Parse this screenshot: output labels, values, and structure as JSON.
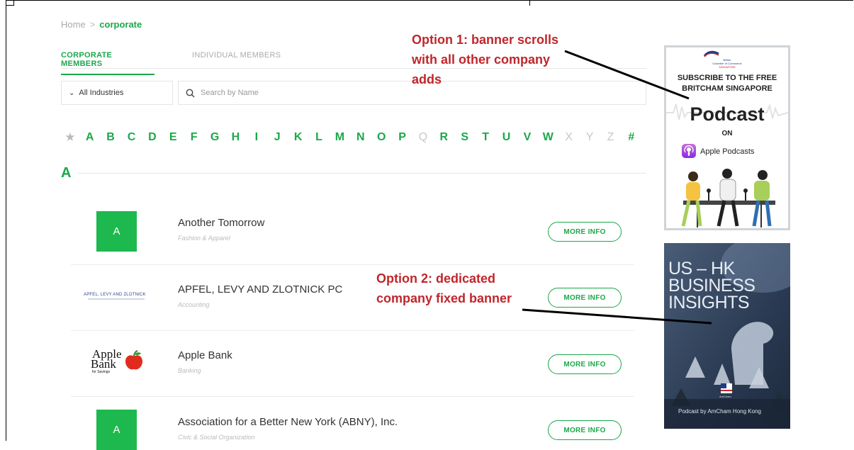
{
  "breadcrumb": {
    "home": "Home",
    "separator": ">",
    "current": "corporate"
  },
  "tabs": {
    "corporate": "CORPORATE MEMBERS",
    "individual": "INDIVIDUAL MEMBERS"
  },
  "filter": {
    "industries": "All Industries",
    "search_placeholder": "Search by Name"
  },
  "alphabet": {
    "enabled": [
      "A",
      "B",
      "C",
      "D",
      "E",
      "F",
      "G",
      "H",
      "I",
      "J",
      "K",
      "L",
      "M",
      "N",
      "O",
      "P",
      "R",
      "S",
      "T",
      "U",
      "V",
      "W",
      "#"
    ],
    "letters": [
      "A",
      "B",
      "C",
      "D",
      "E",
      "F",
      "G",
      "H",
      "I",
      "J",
      "K",
      "L",
      "M",
      "N",
      "O",
      "P",
      "Q",
      "R",
      "S",
      "T",
      "U",
      "V",
      "W",
      "X",
      "Y",
      "Z",
      "#"
    ]
  },
  "section_letter": "A",
  "companies": [
    {
      "name": "Another Tomorrow",
      "category": "Fashion & Apparel",
      "logo_letter": "A"
    },
    {
      "name": "APFEL, LEVY AND ZLOTNICK PC",
      "category": "Accounting",
      "logo_text": "APFEL, LEVY AND ZLOTNICK"
    },
    {
      "name": "Apple Bank",
      "category": "Banking",
      "logo_text_1": "Apple",
      "logo_text_2": "Bank",
      "logo_text_3": "for Savings"
    },
    {
      "name": "Association for a Better New York (ABNY), Inc.",
      "category": "Civic & Social Organization",
      "logo_letter": "A"
    }
  ],
  "more_info_label": "MORE INFO",
  "annotations": {
    "option1_line1": "Option 1: banner scrolls",
    "option1_line2": "with all other company",
    "option1_line3": "adds",
    "option2_line1": "Option 2: dedicated",
    "option2_line2": "company fixed banner"
  },
  "banner1": {
    "org_line1": "British",
    "org_line2": "Chamber of Commerce",
    "org_line3": "SINGAPORE",
    "headline1": "SUBSCRIBE TO THE FREE",
    "headline2": "BRITCHAM SINGAPORE",
    "podcast": "Podcast",
    "on": "ON",
    "platform": "Apple Podcasts"
  },
  "banner2": {
    "title1": "US – HK",
    "title2": "BUSINESS",
    "title3": "INSIGHTS",
    "footer": "Podcast by AmCham Hong Kong",
    "badge": "AmCham"
  },
  "colors": {
    "brand_green": "#1aa84a",
    "annotation_red": "#c0262b"
  }
}
